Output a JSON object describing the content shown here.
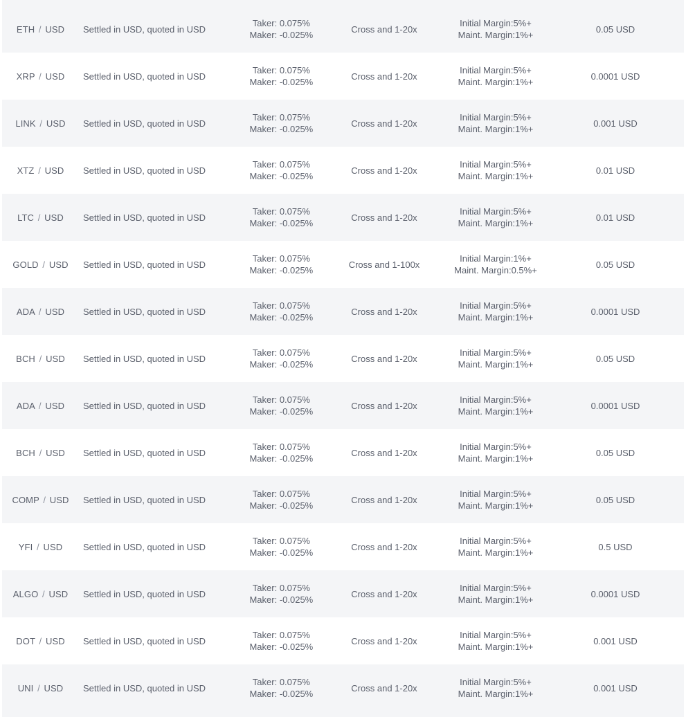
{
  "rows": [
    {
      "base": "ETH",
      "quote": "USD",
      "settlement": "Settled in USD, quoted in USD",
      "taker_label": "Taker:",
      "taker": "0.075%",
      "maker_label": "Maker:",
      "maker": "-0.025%",
      "leverage": "Cross and 1-20x",
      "initial_margin": "Initial Margin:5%+",
      "maint_margin": "Maint. Margin:1%+",
      "tick": "0.05 USD"
    },
    {
      "base": "XRP",
      "quote": "USD",
      "settlement": "Settled in USD, quoted in USD",
      "taker_label": "Taker:",
      "taker": "0.075%",
      "maker_label": "Maker:",
      "maker": "-0.025%",
      "leverage": "Cross and 1-20x",
      "initial_margin": "Initial Margin:5%+",
      "maint_margin": "Maint. Margin:1%+",
      "tick": "0.0001 USD"
    },
    {
      "base": "LINK",
      "quote": "USD",
      "settlement": "Settled in USD, quoted in USD",
      "taker_label": "Taker:",
      "taker": "0.075%",
      "maker_label": "Maker:",
      "maker": "-0.025%",
      "leverage": "Cross and 1-20x",
      "initial_margin": "Initial Margin:5%+",
      "maint_margin": "Maint. Margin:1%+",
      "tick": "0.001 USD"
    },
    {
      "base": "XTZ",
      "quote": "USD",
      "settlement": "Settled in USD, quoted in USD",
      "taker_label": "Taker:",
      "taker": "0.075%",
      "maker_label": "Maker:",
      "maker": "-0.025%",
      "leverage": "Cross and 1-20x",
      "initial_margin": "Initial Margin:5%+",
      "maint_margin": "Maint. Margin:1%+",
      "tick": "0.01 USD"
    },
    {
      "base": "LTC",
      "quote": "USD",
      "settlement": "Settled in USD, quoted in USD",
      "taker_label": "Taker:",
      "taker": "0.075%",
      "maker_label": "Maker:",
      "maker": "-0.025%",
      "leverage": "Cross and 1-20x",
      "initial_margin": "Initial Margin:5%+",
      "maint_margin": "Maint. Margin:1%+",
      "tick": "0.01 USD"
    },
    {
      "base": "GOLD",
      "quote": "USD",
      "settlement": "Settled in USD, quoted in USD",
      "taker_label": "Taker:",
      "taker": "0.075%",
      "maker_label": "Maker:",
      "maker": "-0.025%",
      "leverage": "Cross and 1-100x",
      "initial_margin": "Initial Margin:1%+",
      "maint_margin": "Maint. Margin:0.5%+",
      "tick": "0.05 USD"
    },
    {
      "base": "ADA",
      "quote": "USD",
      "settlement": "Settled in USD, quoted in USD",
      "taker_label": "Taker:",
      "taker": "0.075%",
      "maker_label": "Maker:",
      "maker": "-0.025%",
      "leverage": "Cross and 1-20x",
      "initial_margin": "Initial Margin:5%+",
      "maint_margin": "Maint. Margin:1%+",
      "tick": "0.0001 USD"
    },
    {
      "base": "BCH",
      "quote": "USD",
      "settlement": "Settled in USD, quoted in USD",
      "taker_label": "Taker:",
      "taker": "0.075%",
      "maker_label": "Maker:",
      "maker": "-0.025%",
      "leverage": "Cross and 1-20x",
      "initial_margin": "Initial Margin:5%+",
      "maint_margin": "Maint. Margin:1%+",
      "tick": "0.05 USD"
    },
    {
      "base": "ADA",
      "quote": "USD",
      "settlement": "Settled in USD, quoted in USD",
      "taker_label": "Taker:",
      "taker": "0.075%",
      "maker_label": "Maker:",
      "maker": "-0.025%",
      "leverage": "Cross and 1-20x",
      "initial_margin": "Initial Margin:5%+",
      "maint_margin": "Maint. Margin:1%+",
      "tick": "0.0001 USD"
    },
    {
      "base": "BCH",
      "quote": "USD",
      "settlement": "Settled in USD, quoted in USD",
      "taker_label": "Taker:",
      "taker": "0.075%",
      "maker_label": "Maker:",
      "maker": "-0.025%",
      "leverage": "Cross and 1-20x",
      "initial_margin": "Initial Margin:5%+",
      "maint_margin": "Maint. Margin:1%+",
      "tick": "0.05 USD"
    },
    {
      "base": "COMP",
      "quote": "USD",
      "settlement": "Settled in USD, quoted in USD",
      "taker_label": "Taker:",
      "taker": "0.075%",
      "maker_label": "Maker:",
      "maker": "-0.025%",
      "leverage": "Cross and 1-20x",
      "initial_margin": "Initial Margin:5%+",
      "maint_margin": "Maint. Margin:1%+",
      "tick": "0.05 USD"
    },
    {
      "base": "YFI",
      "quote": "USD",
      "settlement": "Settled in USD, quoted in USD",
      "taker_label": "Taker:",
      "taker": "0.075%",
      "maker_label": "Maker:",
      "maker": "-0.025%",
      "leverage": "Cross and 1-20x",
      "initial_margin": "Initial Margin:5%+",
      "maint_margin": "Maint. Margin:1%+",
      "tick": "0.5 USD"
    },
    {
      "base": "ALGO",
      "quote": "USD",
      "settlement": "Settled in USD, quoted in USD",
      "taker_label": "Taker:",
      "taker": "0.075%",
      "maker_label": "Maker:",
      "maker": "-0.025%",
      "leverage": "Cross and 1-20x",
      "initial_margin": "Initial Margin:5%+",
      "maint_margin": "Maint. Margin:1%+",
      "tick": "0.0001 USD"
    },
    {
      "base": "DOT",
      "quote": "USD",
      "settlement": "Settled in USD, quoted in USD",
      "taker_label": "Taker:",
      "taker": "0.075%",
      "maker_label": "Maker:",
      "maker": "-0.025%",
      "leverage": "Cross and 1-20x",
      "initial_margin": "Initial Margin:5%+",
      "maint_margin": "Maint. Margin:1%+",
      "tick": "0.001 USD"
    },
    {
      "base": "UNI",
      "quote": "USD",
      "settlement": "Settled in USD, quoted in USD",
      "taker_label": "Taker:",
      "taker": "0.075%",
      "maker_label": "Maker:",
      "maker": "-0.025%",
      "leverage": "Cross and 1-20x",
      "initial_margin": "Initial Margin:5%+",
      "maint_margin": "Maint. Margin:1%+",
      "tick": "0.001 USD"
    }
  ],
  "pair_separator": "/"
}
